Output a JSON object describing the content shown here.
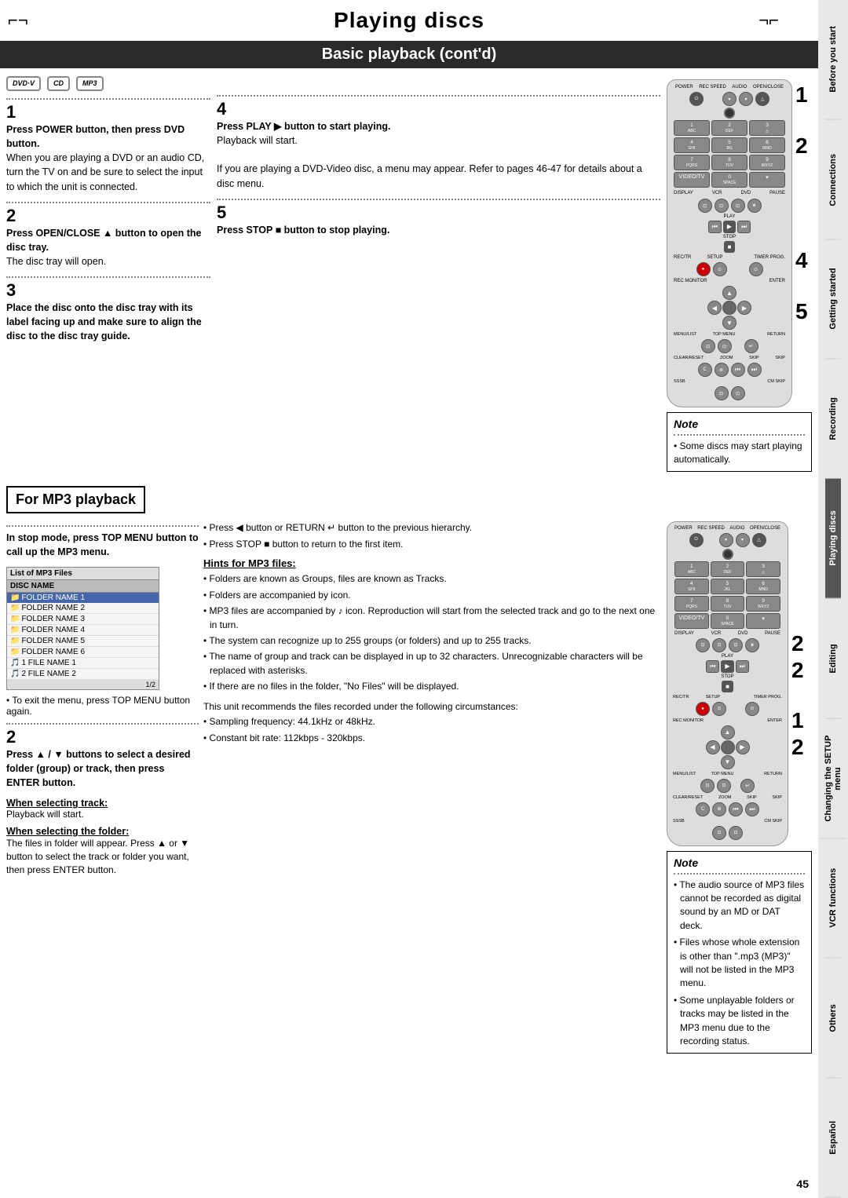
{
  "title": "Playing discs",
  "section1_header": "Basic playback (cont'd)",
  "formats": [
    "DVD·V",
    "CD",
    "MP3"
  ],
  "steps": {
    "step1": {
      "number": "1",
      "heading": "Press POWER button, then press DVD button.",
      "body": "When you are playing a DVD or an audio CD, turn the TV on and be sure to select the input to which the unit is connected."
    },
    "step2": {
      "number": "2",
      "heading": "Press OPEN/CLOSE ▲ button to open the disc tray.",
      "body": "The disc tray will open."
    },
    "step3": {
      "number": "3",
      "heading": "Place the disc onto the disc tray with its label facing up and make sure to align the disc to the disc tray guide."
    },
    "step4": {
      "number": "4",
      "heading": "Press PLAY ▶ button to start playing.",
      "body1": "Playback will start.",
      "body2": "If you are playing a DVD-Video disc, a menu may appear. Refer to pages 46-47 for details about a disc menu."
    },
    "step5": {
      "number": "5",
      "heading": "Press STOP ■ button to stop playing."
    }
  },
  "note1": {
    "title": "Note",
    "bullet": "Some discs may start playing automatically."
  },
  "remote_labels_top": [
    "1",
    "2",
    "4",
    "5"
  ],
  "mp3_section": {
    "header": "For MP3 playback",
    "step1": {
      "heading": "In stop mode, press TOP MENU button to call up the MP3 menu."
    },
    "mp3_list": {
      "header": "List of MP3 Files",
      "subheader": "DISC NAME",
      "highlight": "FOLDER NAME 1",
      "items": [
        "FOLDER NAME 2",
        "FOLDER NAME 3",
        "FOLDER NAME 4",
        "FOLDER NAME 5",
        "FOLDER NAME 6",
        "1  FILE NAME 1",
        "2  FILE NAME 2"
      ],
      "page": "1/2"
    },
    "exit_note": "• To exit the menu, press TOP MENU button again.",
    "step2": {
      "heading": "Press ▲ / ▼ buttons to select a desired folder (group) or track, then press ENTER button."
    },
    "when_track": {
      "heading": "When selecting track:",
      "body": "Playback will start."
    },
    "when_folder": {
      "heading": "When selecting the folder:",
      "body": "The files in folder will appear. Press ▲ or ▼ button to select the track or folder you want, then press ENTER button."
    },
    "middle_bullets": [
      "Press ◀ button or RETURN ↵ button to the previous hierarchy.",
      "Press STOP ■ button to return to the first item."
    ],
    "hints_heading": "Hints for MP3 files:",
    "hints": [
      "Folders are known as Groups, files are known as Tracks.",
      "Folders are accompanied by  icon.",
      "MP3 files are accompanied by ♪ icon. Reproduction will start from the selected track and go to the next one in turn.",
      "The system can recognize up to 255 groups (or folders) and up to 255 tracks.",
      "The name of group and track can be displayed in up to 32 characters. Unrecognizable characters will be replaced with asterisks.",
      "If there are no files in the folder, \"No Files\" will be displayed."
    ],
    "recommend_text": "This unit recommends the files recorded under the following circumstances:",
    "recommend_bullets": [
      "Sampling frequency: 44.1kHz or 48kHz.",
      "Constant bit rate: 112kbps - 320kbps."
    ]
  },
  "note2": {
    "title": "Note",
    "bullets": [
      "The audio source of MP3 files cannot be recorded as digital sound by an MD or DAT deck.",
      "Files whose whole extension is other than \".mp3 (MP3)\" will not be listed in the MP3 menu.",
      "Some unplayable folders or tracks may be listed in the MP3 menu due to the recording status."
    ]
  },
  "page_number": "45",
  "sidebar": {
    "items": [
      "Before you start",
      "Connections",
      "Getting started",
      "Recording",
      "Playing discs",
      "Editing",
      "Changing the SETUP menu",
      "VCR functions",
      "Others",
      "Español"
    ]
  }
}
